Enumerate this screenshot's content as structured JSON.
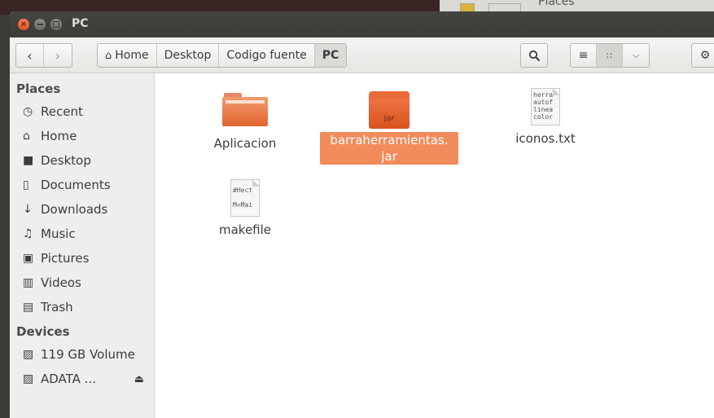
{
  "window": {
    "title": "PC",
    "background_title": "Places"
  },
  "toolbar": {
    "back_icon": "chevron-left",
    "forward_icon": "chevron-right",
    "breadcrumbs": [
      "Home",
      "Desktop",
      "Codigo fuente",
      "PC"
    ],
    "active_crumb": "PC"
  },
  "sidebar": {
    "places_heading": "Places",
    "places": [
      {
        "label": "Recent",
        "icon": "clock"
      },
      {
        "label": "Home",
        "icon": "home"
      },
      {
        "label": "Desktop",
        "icon": "folder"
      },
      {
        "label": "Documents",
        "icon": "document"
      },
      {
        "label": "Downloads",
        "icon": "download"
      },
      {
        "label": "Music",
        "icon": "music"
      },
      {
        "label": "Pictures",
        "icon": "camera"
      },
      {
        "label": "Videos",
        "icon": "film"
      },
      {
        "label": "Trash",
        "icon": "trash"
      }
    ],
    "devices_heading": "Devices",
    "devices": [
      {
        "label": "119 GB Volume",
        "icon": "drive"
      },
      {
        "label": "ADATA ...",
        "icon": "drive",
        "ejectable": true
      }
    ]
  },
  "files": [
    {
      "name": "Aplicacion",
      "type": "folder"
    },
    {
      "name_line1": "barraherramientas.",
      "name_line2": "jar",
      "type": "jar",
      "selected": true,
      "icon_text": "jar"
    },
    {
      "name": "iconos.txt",
      "type": "text",
      "preview": "herra\nautof\nlinea\ncolor"
    },
    {
      "name": "makefile",
      "type": "text",
      "preview": "#Hect\n\nM=Mai"
    }
  ],
  "colors": {
    "accent": "#f28b5a",
    "titlebar": "#3c3b37",
    "close_button": "#e2521d"
  }
}
